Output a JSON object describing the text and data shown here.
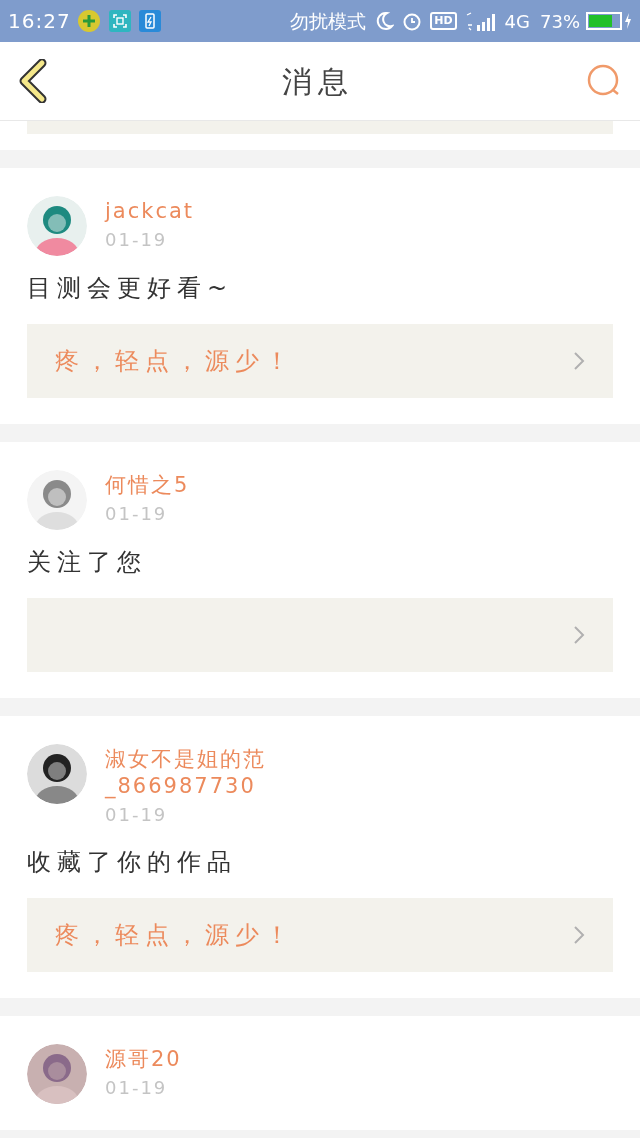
{
  "status_bar": {
    "time": "16:27",
    "mode": "勿扰模式",
    "hd": "HD",
    "network": "4G",
    "battery": "73%"
  },
  "header": {
    "title": "消息"
  },
  "messages": [
    {
      "user": "jackcat",
      "date": "01-19",
      "text": "目测会更好看~",
      "work": "疼，轻点，源少！"
    },
    {
      "user": "何惜之5",
      "date": "01-19",
      "text": "关注了您",
      "work_box": true
    },
    {
      "user": "淑女不是姐的范_866987730",
      "date": "01-19",
      "text": "收藏了你的作品",
      "work": "疼，轻点，源少！"
    },
    {
      "user": "源哥20",
      "date": "01-19"
    }
  ]
}
